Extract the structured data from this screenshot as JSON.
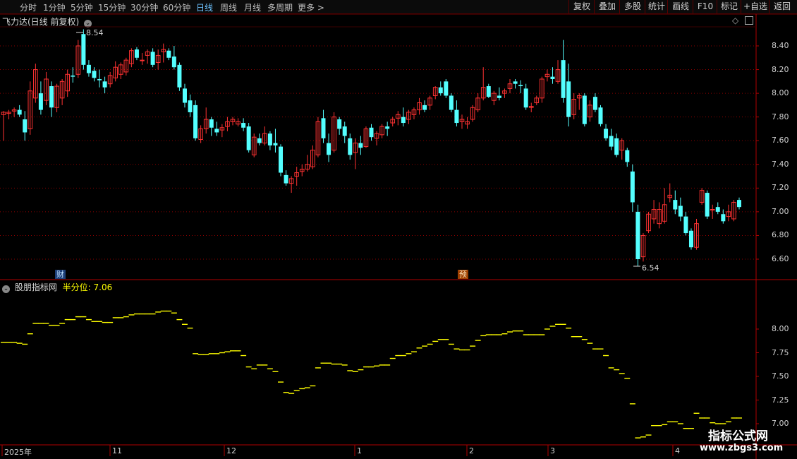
{
  "toolbar": {
    "periods": [
      {
        "label": "分时",
        "x": 28
      },
      {
        "label": "1分钟",
        "x": 61
      },
      {
        "label": "5分钟",
        "x": 100
      },
      {
        "label": "15分钟",
        "x": 139
      },
      {
        "label": "30分钟",
        "x": 185
      },
      {
        "label": "60分钟",
        "x": 231
      },
      {
        "label": "日线",
        "x": 278,
        "active": true
      },
      {
        "label": "周线",
        "x": 312
      },
      {
        "label": "月线",
        "x": 346
      },
      {
        "label": "多周期",
        "x": 379
      },
      {
        "label": "更多 >",
        "x": 422
      }
    ],
    "right_buttons": [
      {
        "label": "复权",
        "x": 806,
        "w": 36
      },
      {
        "label": "叠加",
        "x": 842,
        "w": 36
      },
      {
        "label": "多股",
        "x": 878,
        "w": 36
      },
      {
        "label": "统计",
        "x": 914,
        "w": 32
      },
      {
        "label": "画线",
        "x": 946,
        "w": 36
      },
      {
        "label": "F10",
        "x": 982,
        "w": 34
      },
      {
        "label": "标记",
        "x": 1016,
        "w": 34
      },
      {
        "label": "+自选",
        "x": 1050,
        "w": 40
      },
      {
        "label": "返回",
        "x": 1090,
        "w": 36
      }
    ]
  },
  "main_chart": {
    "title": "飞力达(日线 前复权)",
    "high_label": "8.54",
    "low_label": "6.54",
    "yticks": [
      "8.40",
      "8.20",
      "8.00",
      "7.80",
      "7.60",
      "7.40",
      "7.20",
      "7.00",
      "6.80",
      "6.60"
    ],
    "markers": [
      {
        "text": "财",
        "type": "finance"
      },
      {
        "text": "预",
        "type": "forecast"
      }
    ]
  },
  "indicator": {
    "name": "股朋指标网",
    "series_label": "半分位:",
    "series_value": "7.06",
    "yticks": [
      "8.00",
      "7.75",
      "7.50",
      "7.25",
      "7.00"
    ]
  },
  "xaxis": {
    "labels": [
      "2025年",
      "11",
      "12",
      "1",
      "2",
      "3",
      "4"
    ]
  },
  "watermark": {
    "line1": "指标公式网",
    "line2": "www.zbgs3.com"
  },
  "colors": {
    "up": "#ff3232",
    "down": "#54ffff",
    "indicator_line": "#ffff00",
    "grid": "#8b0000",
    "active_period": "#6ec3ff"
  },
  "chart_data": {
    "type": "candlestick",
    "ylim": [
      6.5,
      8.6
    ],
    "ohlc": [
      [
        7.82,
        7.85,
        7.6,
        7.84
      ],
      [
        7.83,
        7.86,
        7.78,
        7.84
      ],
      [
        7.85,
        7.88,
        7.8,
        7.86
      ],
      [
        7.86,
        7.9,
        7.8,
        7.82
      ],
      [
        7.78,
        7.85,
        7.6,
        7.67
      ],
      [
        7.7,
        8.1,
        7.65,
        8.02
      ],
      [
        7.96,
        8.25,
        7.92,
        8.2
      ],
      [
        8.0,
        8.1,
        7.82,
        7.86
      ],
      [
        7.94,
        8.18,
        7.9,
        8.12
      ],
      [
        8.06,
        8.1,
        7.8,
        7.88
      ],
      [
        7.88,
        8.08,
        7.84,
        8.06
      ],
      [
        7.96,
        8.12,
        7.9,
        8.1
      ],
      [
        8.02,
        8.2,
        7.97,
        8.16
      ],
      [
        8.15,
        8.22,
        8.09,
        8.14
      ],
      [
        8.16,
        8.45,
        8.13,
        8.4
      ],
      [
        8.5,
        8.54,
        8.2,
        8.24
      ],
      [
        8.24,
        8.28,
        8.14,
        8.17
      ],
      [
        8.19,
        8.22,
        8.1,
        8.13
      ],
      [
        8.12,
        8.2,
        8.05,
        8.11
      ],
      [
        8.1,
        8.14,
        8.0,
        8.05
      ],
      [
        8.08,
        8.18,
        8.05,
        8.15
      ],
      [
        8.13,
        8.27,
        8.1,
        8.22
      ],
      [
        8.16,
        8.26,
        8.12,
        8.24
      ],
      [
        8.18,
        8.3,
        8.15,
        8.28
      ],
      [
        8.25,
        8.38,
        8.22,
        8.36
      ],
      [
        8.37,
        8.39,
        8.28,
        8.3
      ],
      [
        8.28,
        8.34,
        8.24,
        8.28
      ],
      [
        8.32,
        8.37,
        8.25,
        8.35
      ],
      [
        8.35,
        8.38,
        8.22,
        8.24
      ],
      [
        8.26,
        8.37,
        8.2,
        8.32
      ],
      [
        8.35,
        8.42,
        8.26,
        8.37
      ],
      [
        8.36,
        8.38,
        8.28,
        8.3
      ],
      [
        8.31,
        8.4,
        8.2,
        8.22
      ],
      [
        8.24,
        8.26,
        8.02,
        8.05
      ],
      [
        8.04,
        8.08,
        7.88,
        7.92
      ],
      [
        7.94,
        7.99,
        7.8,
        7.84
      ],
      [
        7.9,
        7.94,
        7.6,
        7.62
      ],
      [
        7.61,
        7.73,
        7.58,
        7.7
      ],
      [
        7.7,
        7.88,
        7.66,
        7.78
      ],
      [
        7.78,
        7.8,
        7.64,
        7.71
      ],
      [
        7.7,
        7.76,
        7.64,
        7.67
      ],
      [
        7.69,
        7.74,
        7.63,
        7.71
      ],
      [
        7.72,
        7.8,
        7.68,
        7.76
      ],
      [
        7.76,
        7.8,
        7.73,
        7.78
      ],
      [
        7.74,
        7.79,
        7.72,
        7.76
      ],
      [
        7.75,
        7.79,
        7.68,
        7.71
      ],
      [
        7.72,
        7.75,
        7.5,
        7.52
      ],
      [
        7.48,
        7.66,
        7.46,
        7.63
      ],
      [
        7.62,
        7.66,
        7.56,
        7.58
      ],
      [
        7.58,
        7.72,
        7.56,
        7.66
      ],
      [
        7.66,
        7.68,
        7.52,
        7.56
      ],
      [
        7.58,
        7.7,
        7.5,
        7.56
      ],
      [
        7.55,
        7.57,
        7.3,
        7.33
      ],
      [
        7.31,
        7.35,
        7.22,
        7.24
      ],
      [
        7.24,
        7.3,
        7.16,
        7.28
      ],
      [
        7.3,
        7.38,
        7.22,
        7.33
      ],
      [
        7.34,
        7.4,
        7.3,
        7.36
      ],
      [
        7.36,
        7.48,
        7.34,
        7.4
      ],
      [
        7.38,
        7.56,
        7.36,
        7.52
      ],
      [
        7.48,
        7.8,
        7.46,
        7.76
      ],
      [
        7.79,
        7.86,
        7.58,
        7.62
      ],
      [
        7.58,
        7.66,
        7.42,
        7.48
      ],
      [
        7.52,
        7.84,
        7.5,
        7.8
      ],
      [
        7.78,
        7.8,
        7.65,
        7.7
      ],
      [
        7.72,
        7.76,
        7.58,
        7.64
      ],
      [
        7.62,
        7.66,
        7.44,
        7.48
      ],
      [
        7.5,
        7.62,
        7.36,
        7.58
      ],
      [
        7.58,
        7.64,
        7.48,
        7.54
      ],
      [
        7.55,
        7.72,
        7.54,
        7.7
      ],
      [
        7.71,
        7.74,
        7.6,
        7.63
      ],
      [
        7.62,
        7.68,
        7.56,
        7.66
      ],
      [
        7.65,
        7.74,
        7.62,
        7.72
      ],
      [
        7.72,
        7.76,
        7.64,
        7.7
      ],
      [
        7.75,
        7.8,
        7.72,
        7.78
      ],
      [
        7.79,
        7.85,
        7.73,
        7.82
      ],
      [
        7.8,
        7.88,
        7.72,
        7.75
      ],
      [
        7.78,
        7.86,
        7.74,
        7.84
      ],
      [
        7.82,
        7.88,
        7.78,
        7.86
      ],
      [
        7.86,
        7.96,
        7.82,
        7.92
      ],
      [
        7.9,
        7.94,
        7.84,
        7.86
      ],
      [
        7.9,
        7.98,
        7.86,
        7.96
      ],
      [
        7.98,
        8.06,
        7.95,
        8.05
      ],
      [
        8.05,
        8.1,
        7.98,
        8.0
      ],
      [
        8.1,
        8.12,
        7.96,
        7.98
      ],
      [
        7.98,
        8.0,
        7.84,
        7.86
      ],
      [
        7.86,
        7.94,
        7.72,
        7.75
      ],
      [
        7.76,
        7.82,
        7.7,
        7.78
      ],
      [
        7.74,
        7.8,
        7.7,
        7.76
      ],
      [
        7.78,
        7.9,
        7.76,
        7.88
      ],
      [
        7.86,
        8.0,
        7.84,
        7.96
      ],
      [
        7.96,
        8.22,
        7.94,
        8.05
      ],
      [
        8.06,
        8.08,
        7.96,
        7.97
      ],
      [
        7.94,
        8.02,
        7.9,
        8.0
      ],
      [
        7.98,
        8.05,
        7.94,
        7.96
      ],
      [
        8.0,
        8.04,
        7.96,
        8.02
      ],
      [
        8.04,
        8.12,
        8.0,
        8.08
      ],
      [
        8.1,
        8.12,
        8.04,
        8.08
      ],
      [
        8.07,
        8.11,
        8.0,
        8.06
      ],
      [
        8.04,
        8.08,
        7.86,
        7.88
      ],
      [
        7.88,
        7.92,
        7.84,
        7.89
      ],
      [
        7.92,
        7.98,
        7.9,
        7.96
      ],
      [
        7.96,
        8.14,
        7.92,
        8.12
      ],
      [
        8.14,
        8.2,
        8.1,
        8.16
      ],
      [
        8.14,
        8.22,
        8.08,
        8.12
      ],
      [
        8.1,
        8.28,
        8.08,
        8.2
      ],
      [
        8.28,
        8.45,
        7.92,
        7.96
      ],
      [
        8.1,
        8.25,
        7.72,
        7.8
      ],
      [
        7.82,
        8.0,
        7.78,
        7.95
      ],
      [
        7.96,
        8.0,
        7.86,
        7.98
      ],
      [
        7.98,
        8.0,
        7.72,
        7.74
      ],
      [
        7.8,
        7.94,
        7.76,
        7.9
      ],
      [
        7.97,
        8.0,
        7.84,
        7.86
      ],
      [
        7.88,
        7.9,
        7.72,
        7.74
      ],
      [
        7.7,
        7.74,
        7.6,
        7.62
      ],
      [
        7.64,
        7.7,
        7.52,
        7.55
      ],
      [
        7.62,
        7.66,
        7.46,
        7.48
      ],
      [
        7.52,
        7.62,
        7.44,
        7.6
      ],
      [
        7.52,
        7.54,
        7.38,
        7.42
      ],
      [
        7.34,
        7.4,
        7.0,
        7.08
      ],
      [
        7.0,
        7.06,
        6.54,
        6.6
      ],
      [
        6.62,
        6.82,
        6.58,
        6.8
      ],
      [
        6.84,
        7.0,
        6.82,
        6.98
      ],
      [
        6.94,
        7.1,
        6.9,
        7.02
      ],
      [
        6.9,
        7.08,
        6.86,
        7.02
      ],
      [
        6.92,
        7.2,
        6.9,
        7.06
      ],
      [
        7.12,
        7.24,
        7.08,
        7.14
      ],
      [
        7.1,
        7.18,
        6.98,
        7.02
      ],
      [
        7.05,
        7.12,
        6.92,
        6.96
      ],
      [
        6.96,
        7.0,
        6.8,
        6.82
      ],
      [
        6.84,
        6.86,
        6.68,
        6.7
      ],
      [
        6.7,
        6.94,
        6.68,
        6.9
      ],
      [
        7.08,
        7.2,
        7.06,
        7.18
      ],
      [
        7.16,
        7.18,
        6.94,
        6.96
      ],
      [
        7.02,
        7.06,
        6.94,
        7.02
      ],
      [
        7.04,
        7.08,
        6.98,
        7.0
      ],
      [
        6.98,
        7.02,
        6.9,
        6.92
      ],
      [
        6.96,
        7.06,
        6.92,
        7.0
      ],
      [
        6.94,
        7.1,
        6.92,
        7.08
      ],
      [
        7.1,
        7.12,
        7.02,
        7.04
      ]
    ],
    "indicator_ylim": [
      6.8,
      8.2
    ],
    "indicator_values": [
      7.86,
      7.86,
      7.86,
      7.85,
      7.84,
      7.95,
      8.06,
      8.06,
      8.06,
      8.04,
      8.04,
      8.06,
      8.1,
      8.1,
      8.13,
      8.13,
      8.1,
      8.08,
      8.08,
      8.07,
      8.07,
      8.12,
      8.12,
      8.13,
      8.15,
      8.16,
      8.16,
      8.16,
      8.16,
      8.18,
      8.19,
      8.19,
      8.17,
      8.1,
      8.05,
      8.01,
      7.74,
      7.73,
      7.73,
      7.74,
      7.74,
      7.75,
      7.76,
      7.77,
      7.77,
      7.72,
      7.6,
      7.58,
      7.62,
      7.62,
      7.58,
      7.55,
      7.44,
      7.33,
      7.32,
      7.35,
      7.37,
      7.38,
      7.4,
      7.59,
      7.64,
      7.64,
      7.63,
      7.63,
      7.62,
      7.56,
      7.55,
      7.57,
      7.6,
      7.6,
      7.61,
      7.62,
      7.62,
      7.69,
      7.72,
      7.72,
      7.74,
      7.76,
      7.8,
      7.82,
      7.84,
      7.87,
      7.89,
      7.89,
      7.84,
      7.79,
      7.78,
      7.78,
      7.82,
      7.88,
      7.93,
      7.94,
      7.94,
      7.94,
      7.95,
      7.97,
      7.98,
      7.98,
      7.94,
      7.94,
      7.94,
      7.94,
      8.0,
      8.03,
      8.05,
      8.05,
      8.01,
      7.92,
      7.92,
      7.89,
      7.85,
      7.79,
      7.79,
      7.72,
      7.59,
      7.57,
      7.53,
      7.48,
      7.21,
      6.85,
      6.86,
      6.88,
      6.98,
      6.98,
      6.99,
      7.02,
      7.02,
      7.0,
      6.95,
      6.95,
      7.11,
      7.06,
      7.06,
      7.01,
      7.0,
      7.0,
      7.02,
      7.06,
      7.06
    ]
  }
}
